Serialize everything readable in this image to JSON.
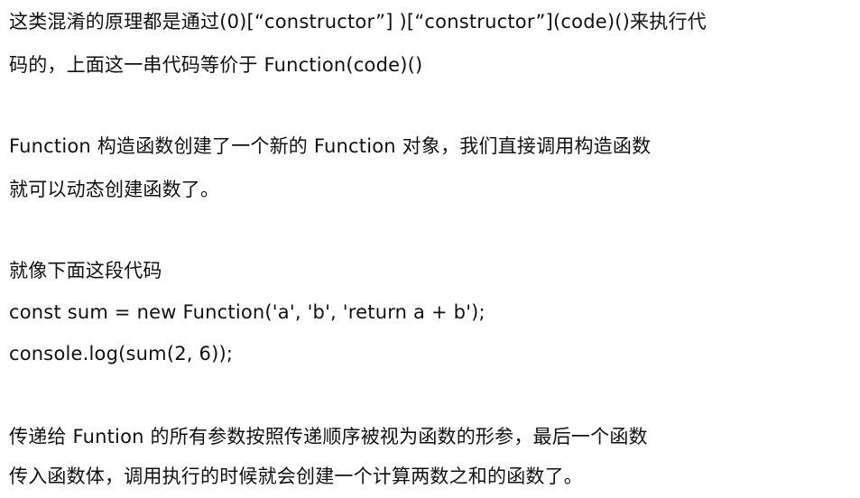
{
  "paragraphs": [
    {
      "lines": [
        "这类混淆的原理都是通过(0)[“constructor”] )[“constructor”](code)()来执行代",
        "码的，上面这一串代码等价于 Function(code)()"
      ]
    },
    {
      "lines": [
        "Function 构造函数创建了一个新的 Function 对象，我们直接调用构造函数",
        "就可以动态创建函数了。"
      ]
    },
    {
      "lines": [
        "就像下面这段代码",
        "const sum = new Function('a', 'b', 'return a + b');",
        "console.log(sum(2, 6));"
      ]
    },
    {
      "lines": [
        "传递给 Funtion 的所有参数按照传递顺序被视为函数的形参，最后一个函数",
        "传入函数体，调用执行的时候就会创建一个计算两数之和的函数了。"
      ]
    }
  ]
}
